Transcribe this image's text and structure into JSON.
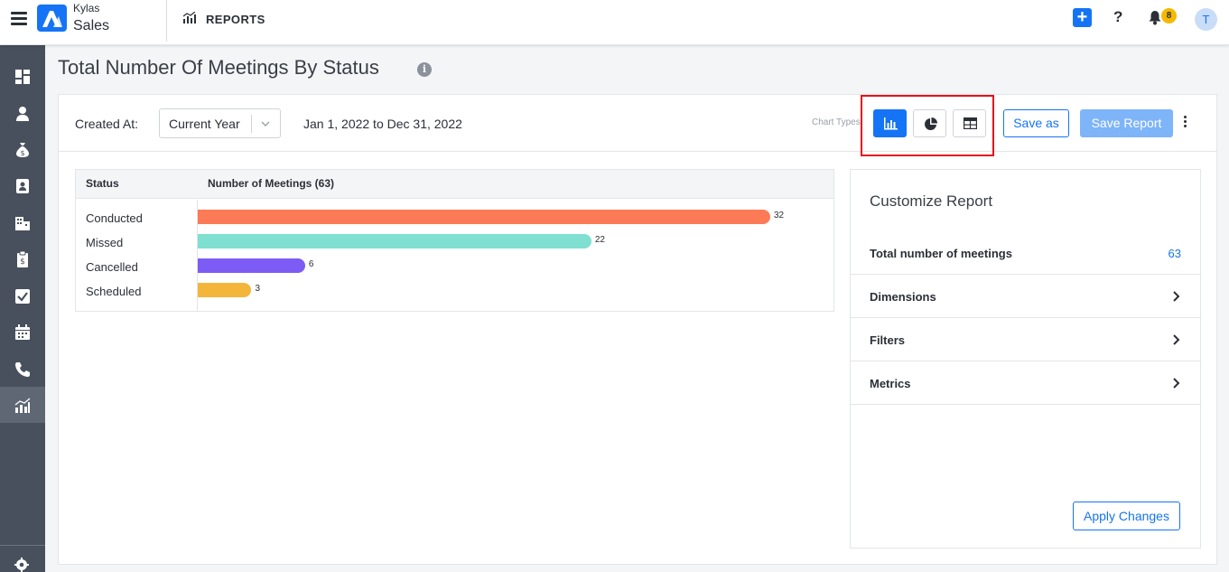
{
  "header": {
    "brand_top": "Kylas",
    "brand_main": "Sales",
    "section": "REPORTS",
    "notification_count": "8",
    "avatar_initial": "T",
    "help_label": "?"
  },
  "page": {
    "title": "Total Number Of Meetings By Status",
    "info_label": "i"
  },
  "filters": {
    "created_label": "Created At:",
    "period_value": "Current Year",
    "date_range": "Jan 1, 2022 to Dec 31, 2022",
    "chart_types_label": "Chart Types:",
    "save_as_label": "Save as",
    "save_report_label": "Save Report"
  },
  "table": {
    "col_status": "Status",
    "col_meetings": "Number of Meetings (63)"
  },
  "chart_data": {
    "type": "bar",
    "orientation": "horizontal",
    "title": "",
    "xlabel": "Number of Meetings (63)",
    "ylabel": "Status",
    "categories": [
      "Conducted",
      "Missed",
      "Cancelled",
      "Scheduled"
    ],
    "values": [
      32,
      22,
      6,
      3
    ],
    "colors": [
      "#fd7a57",
      "#7fe0d2",
      "#7d5cf5",
      "#f4b63a"
    ],
    "xlim": [
      0,
      35
    ],
    "grid": false,
    "legend": "none"
  },
  "customize": {
    "title": "Customize Report",
    "total_label": "Total number of meetings",
    "total_value": "63",
    "rows": [
      "Dimensions",
      "Filters",
      "Metrics"
    ],
    "apply_label": "Apply Changes"
  },
  "colors": {
    "accent": "#1574f5",
    "sidebar": "#48505d",
    "highlight": "#e3101c"
  },
  "icons": {
    "sidebar": [
      "dashboard-icon",
      "user-icon",
      "money-bag-icon",
      "contact-card-icon",
      "building-icon",
      "clipboard-dollar-icon",
      "task-check-icon",
      "calendar-icon",
      "phone-icon",
      "reports-icon"
    ],
    "chart_types": [
      "bar-chart-icon",
      "pie-chart-icon",
      "table-icon"
    ]
  }
}
